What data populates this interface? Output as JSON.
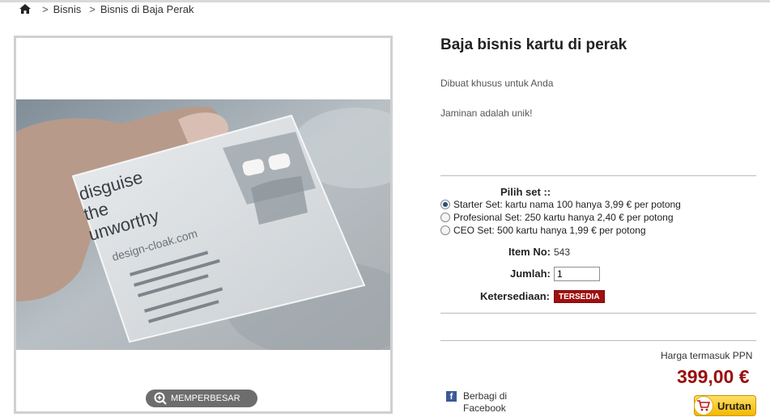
{
  "breadcrumb": {
    "home_icon": "home-icon",
    "separator": ">",
    "items": [
      "Bisnis",
      "Bisnis di Baja Perak"
    ]
  },
  "gallery": {
    "zoom_label": "MEMPERBESAR",
    "zoom_icon": "magnifier-plus-icon"
  },
  "product": {
    "title": "Baja bisnis kartu di perak",
    "description_1": "Dibuat khusus untuk Anda",
    "description_2": "Jaminan adalah unik!"
  },
  "sets": {
    "label": "Pilih set ::",
    "options": [
      {
        "label": "Starter Set: kartu nama 100 hanya 3,99 € per potong",
        "checked": true
      },
      {
        "label": "Profesional Set: 250 kartu hanya 2,40 € per potong",
        "checked": false
      },
      {
        "label": "CEO Set: 500 kartu hanya 1,99 € per potong",
        "checked": false
      }
    ]
  },
  "details": {
    "item_no_label": "Item No:",
    "item_no_value": "543",
    "quantity_label": "Jumlah:",
    "quantity_value": "1",
    "availability_label": "Ketersediaan:",
    "availability_value": "TERSEDIA"
  },
  "pricing": {
    "note": "Harga termasuk PPN",
    "price": "399,00 €",
    "order_label": "Urutan"
  },
  "share": {
    "facebook_label_1": "Berbagi di",
    "facebook_label_2": "Facebook"
  },
  "colors": {
    "price": "#9a0d0d",
    "badge": "#a01010",
    "order_button": "#f5b800",
    "facebook": "#3b5998"
  }
}
